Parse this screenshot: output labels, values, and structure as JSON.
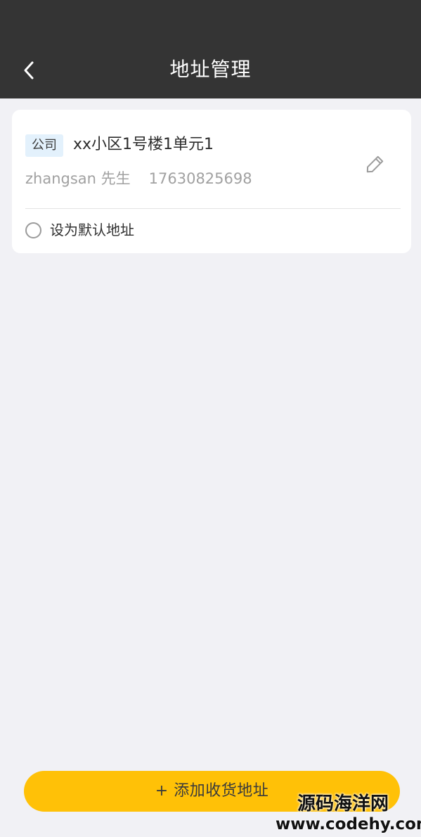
{
  "header": {
    "title": "地址管理",
    "back_icon": "chevron-left-icon"
  },
  "addresses": [
    {
      "tag": "公司",
      "address": "xx小区1号楼1单元1",
      "name": "zhangsan 先生",
      "phone": "17630825698",
      "edit_icon": "pencil-icon",
      "default_label": "设为默认地址",
      "is_default": false
    }
  ],
  "actions": {
    "add_address_label": "+ 添加收货地址"
  },
  "watermark": {
    "site_name": "源码海洋网",
    "site_url": "www.codehy.com"
  },
  "colors": {
    "header_bg": "#343434",
    "page_bg": "#f1f1f5",
    "card_bg": "#ffffff",
    "tag_bg": "#e3f1fc",
    "accent": "#ffc107"
  }
}
